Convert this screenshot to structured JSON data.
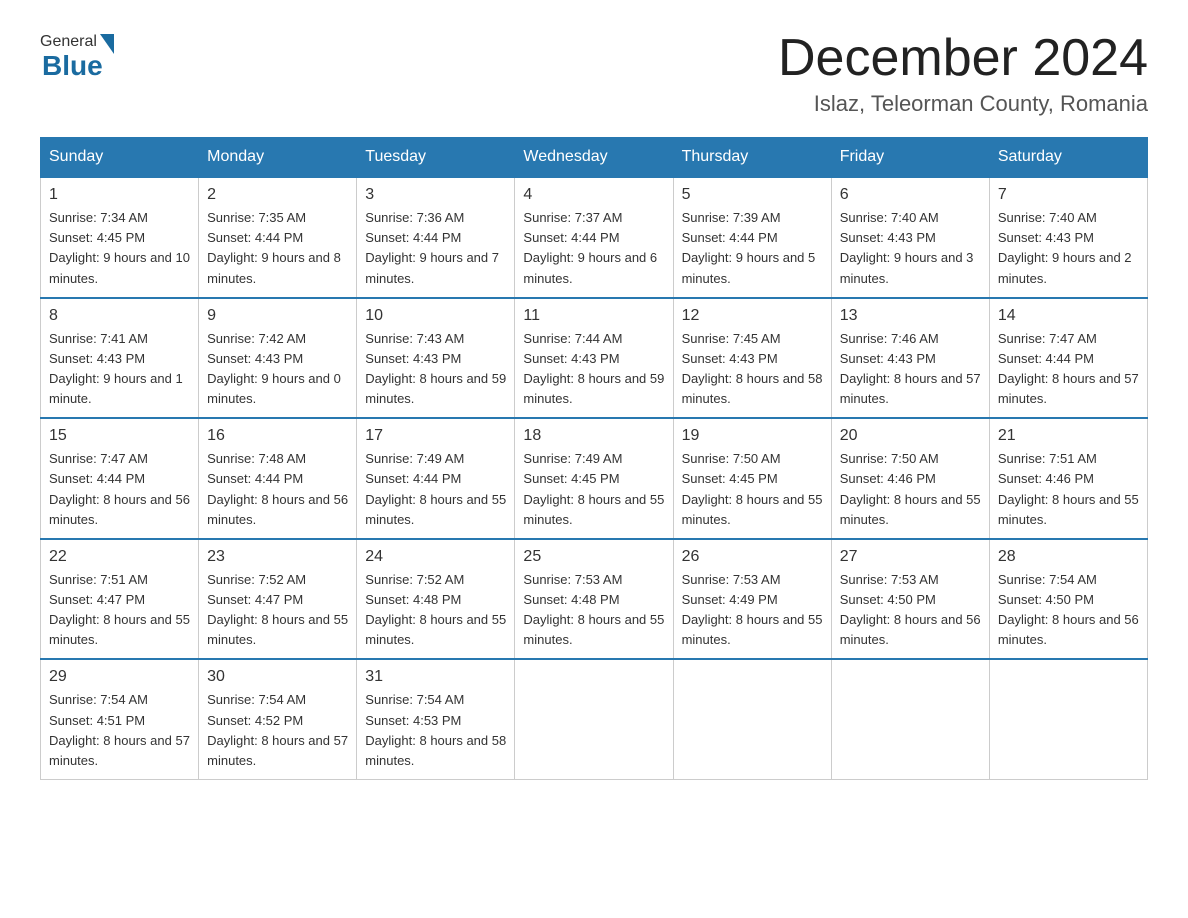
{
  "header": {
    "logo_general": "General",
    "logo_blue": "Blue",
    "month_title": "December 2024",
    "location": "Islaz, Teleorman County, Romania"
  },
  "days_of_week": [
    "Sunday",
    "Monday",
    "Tuesday",
    "Wednesday",
    "Thursday",
    "Friday",
    "Saturday"
  ],
  "weeks": [
    [
      {
        "num": "1",
        "sunrise": "7:34 AM",
        "sunset": "4:45 PM",
        "daylight": "9 hours and 10 minutes."
      },
      {
        "num": "2",
        "sunrise": "7:35 AM",
        "sunset": "4:44 PM",
        "daylight": "9 hours and 8 minutes."
      },
      {
        "num": "3",
        "sunrise": "7:36 AM",
        "sunset": "4:44 PM",
        "daylight": "9 hours and 7 minutes."
      },
      {
        "num": "4",
        "sunrise": "7:37 AM",
        "sunset": "4:44 PM",
        "daylight": "9 hours and 6 minutes."
      },
      {
        "num": "5",
        "sunrise": "7:39 AM",
        "sunset": "4:44 PM",
        "daylight": "9 hours and 5 minutes."
      },
      {
        "num": "6",
        "sunrise": "7:40 AM",
        "sunset": "4:43 PM",
        "daylight": "9 hours and 3 minutes."
      },
      {
        "num": "7",
        "sunrise": "7:40 AM",
        "sunset": "4:43 PM",
        "daylight": "9 hours and 2 minutes."
      }
    ],
    [
      {
        "num": "8",
        "sunrise": "7:41 AM",
        "sunset": "4:43 PM",
        "daylight": "9 hours and 1 minute."
      },
      {
        "num": "9",
        "sunrise": "7:42 AM",
        "sunset": "4:43 PM",
        "daylight": "9 hours and 0 minutes."
      },
      {
        "num": "10",
        "sunrise": "7:43 AM",
        "sunset": "4:43 PM",
        "daylight": "8 hours and 59 minutes."
      },
      {
        "num": "11",
        "sunrise": "7:44 AM",
        "sunset": "4:43 PM",
        "daylight": "8 hours and 59 minutes."
      },
      {
        "num": "12",
        "sunrise": "7:45 AM",
        "sunset": "4:43 PM",
        "daylight": "8 hours and 58 minutes."
      },
      {
        "num": "13",
        "sunrise": "7:46 AM",
        "sunset": "4:43 PM",
        "daylight": "8 hours and 57 minutes."
      },
      {
        "num": "14",
        "sunrise": "7:47 AM",
        "sunset": "4:44 PM",
        "daylight": "8 hours and 57 minutes."
      }
    ],
    [
      {
        "num": "15",
        "sunrise": "7:47 AM",
        "sunset": "4:44 PM",
        "daylight": "8 hours and 56 minutes."
      },
      {
        "num": "16",
        "sunrise": "7:48 AM",
        "sunset": "4:44 PM",
        "daylight": "8 hours and 56 minutes."
      },
      {
        "num": "17",
        "sunrise": "7:49 AM",
        "sunset": "4:44 PM",
        "daylight": "8 hours and 55 minutes."
      },
      {
        "num": "18",
        "sunrise": "7:49 AM",
        "sunset": "4:45 PM",
        "daylight": "8 hours and 55 minutes."
      },
      {
        "num": "19",
        "sunrise": "7:50 AM",
        "sunset": "4:45 PM",
        "daylight": "8 hours and 55 minutes."
      },
      {
        "num": "20",
        "sunrise": "7:50 AM",
        "sunset": "4:46 PM",
        "daylight": "8 hours and 55 minutes."
      },
      {
        "num": "21",
        "sunrise": "7:51 AM",
        "sunset": "4:46 PM",
        "daylight": "8 hours and 55 minutes."
      }
    ],
    [
      {
        "num": "22",
        "sunrise": "7:51 AM",
        "sunset": "4:47 PM",
        "daylight": "8 hours and 55 minutes."
      },
      {
        "num": "23",
        "sunrise": "7:52 AM",
        "sunset": "4:47 PM",
        "daylight": "8 hours and 55 minutes."
      },
      {
        "num": "24",
        "sunrise": "7:52 AM",
        "sunset": "4:48 PM",
        "daylight": "8 hours and 55 minutes."
      },
      {
        "num": "25",
        "sunrise": "7:53 AM",
        "sunset": "4:48 PM",
        "daylight": "8 hours and 55 minutes."
      },
      {
        "num": "26",
        "sunrise": "7:53 AM",
        "sunset": "4:49 PM",
        "daylight": "8 hours and 55 minutes."
      },
      {
        "num": "27",
        "sunrise": "7:53 AM",
        "sunset": "4:50 PM",
        "daylight": "8 hours and 56 minutes."
      },
      {
        "num": "28",
        "sunrise": "7:54 AM",
        "sunset": "4:50 PM",
        "daylight": "8 hours and 56 minutes."
      }
    ],
    [
      {
        "num": "29",
        "sunrise": "7:54 AM",
        "sunset": "4:51 PM",
        "daylight": "8 hours and 57 minutes."
      },
      {
        "num": "30",
        "sunrise": "7:54 AM",
        "sunset": "4:52 PM",
        "daylight": "8 hours and 57 minutes."
      },
      {
        "num": "31",
        "sunrise": "7:54 AM",
        "sunset": "4:53 PM",
        "daylight": "8 hours and 58 minutes."
      },
      null,
      null,
      null,
      null
    ]
  ]
}
